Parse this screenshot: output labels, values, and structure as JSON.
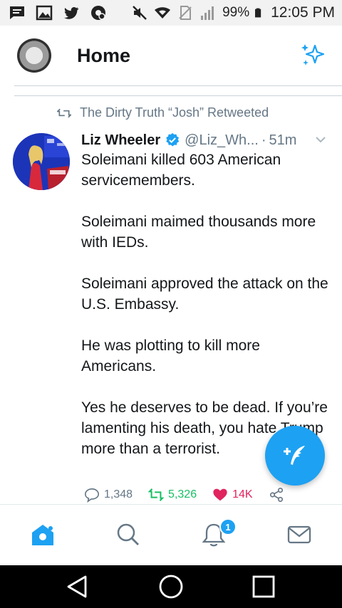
{
  "status_bar": {
    "battery": "99%",
    "time": "12:05 PM"
  },
  "header": {
    "title": "Home"
  },
  "tweet": {
    "retweeted_by": "The Dirty Truth “Josh” Retweeted",
    "author": "Liz Wheeler",
    "handle": "@Liz_Wh...",
    "separator": "·",
    "time": "51m",
    "text": "Soleimani killed 603 American servicemembers.\n\nSoleimani maimed thousands more with IEDs.\n\nSoleimani approved the attack on the U.S. Embassy.\n\nHe was plotting to kill more Americans.\n\nYes he deserves to be dead. If you’re lamenting his death, you hate Trump more than a terrorist.",
    "replies": "1,348",
    "retweets": "5,326",
    "likes": "14K"
  },
  "tabs": {
    "notification_badge": "1"
  },
  "colors": {
    "accent": "#1da1f2",
    "retweet": "#17bf63",
    "like": "#e0245e",
    "muted": "#657786"
  }
}
